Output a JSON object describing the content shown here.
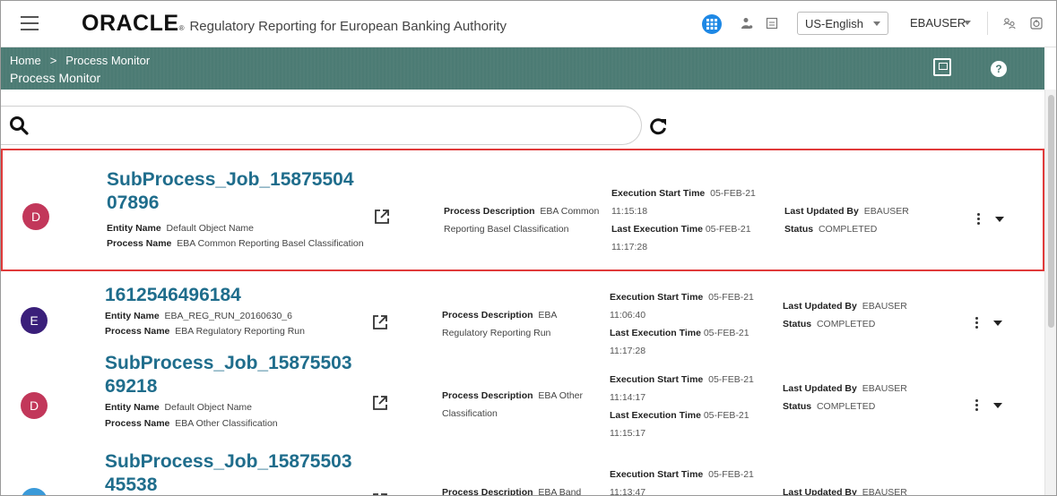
{
  "header": {
    "brand": "ORACLE",
    "brand_mark": "®",
    "app_title": "Regulatory Reporting for European Banking Authority",
    "language": "US-English",
    "user": "EBAUSER"
  },
  "nav": {
    "breadcrumb": [
      "Home",
      ">",
      "Process Monitor"
    ],
    "page_title": "Process Monitor",
    "help_label": "?"
  },
  "search": {
    "placeholder": ""
  },
  "labels": {
    "entity_name": "Entity Name",
    "process_name": "Process Name",
    "process_description": "Process Description",
    "execution_start_time": "Execution Start Time",
    "last_execution_time": "Last Execution Time",
    "last_updated_by": "Last Updated By",
    "status": "Status"
  },
  "rows": [
    {
      "avatar": "D",
      "avatar_color": "#c2375a",
      "title": "SubProcess_Job_1587550407896",
      "entity_name": "Default Object Name",
      "process_name": "EBA Common Reporting Basel Classification",
      "process_description": "EBA Common Reporting Basel Classification",
      "execution_start_time": "05-FEB-21 11:15:18",
      "last_execution_time": "05-FEB-21 11:17:28",
      "last_updated_by": "EBAUSER",
      "status": "COMPLETED"
    },
    {
      "avatar": "E",
      "avatar_color": "#3a1f7a",
      "title": "1612546496184",
      "entity_name": "EBA_REG_RUN_20160630_6",
      "process_name": "EBA Regulatory Reporting Run",
      "process_description": "EBA Regulatory Reporting Run",
      "execution_start_time": "05-FEB-21 11:06:40",
      "last_execution_time": "05-FEB-21 11:17:28",
      "last_updated_by": "EBAUSER",
      "status": "COMPLETED"
    },
    {
      "avatar": "D",
      "avatar_color": "#c2375a",
      "title": "SubProcess_Job_1587550369218",
      "entity_name": "Default Object Name",
      "process_name": "EBA Other Classification",
      "process_description": "EBA Other Classification",
      "execution_start_time": "05-FEB-21 11:14:17",
      "last_execution_time": "05-FEB-21 11:15:17",
      "last_updated_by": "EBAUSER",
      "status": "COMPLETED"
    },
    {
      "avatar": "D",
      "avatar_color": "#3a9ad9",
      "title": "SubProcess_Job_1587550345538",
      "process_description": "EBA Band Classi",
      "execution_start_time": "05-FEB-21 11:13:47",
      "last_updated_by": "EBAUSER"
    }
  ],
  "colors": {
    "accent": "#1f6d8c",
    "teal_bar": "#4a7a73",
    "selection": "#e03a3a",
    "apps_button": "#1e88e5"
  },
  "icons": [
    "menu-icon",
    "apps-grid-icon",
    "person-icon",
    "calendar-icon",
    "org-icon",
    "power-icon",
    "screen-icon",
    "help-icon",
    "search-icon",
    "refresh-icon",
    "open-external-icon",
    "kebab-icon",
    "chevron-down-icon"
  ]
}
